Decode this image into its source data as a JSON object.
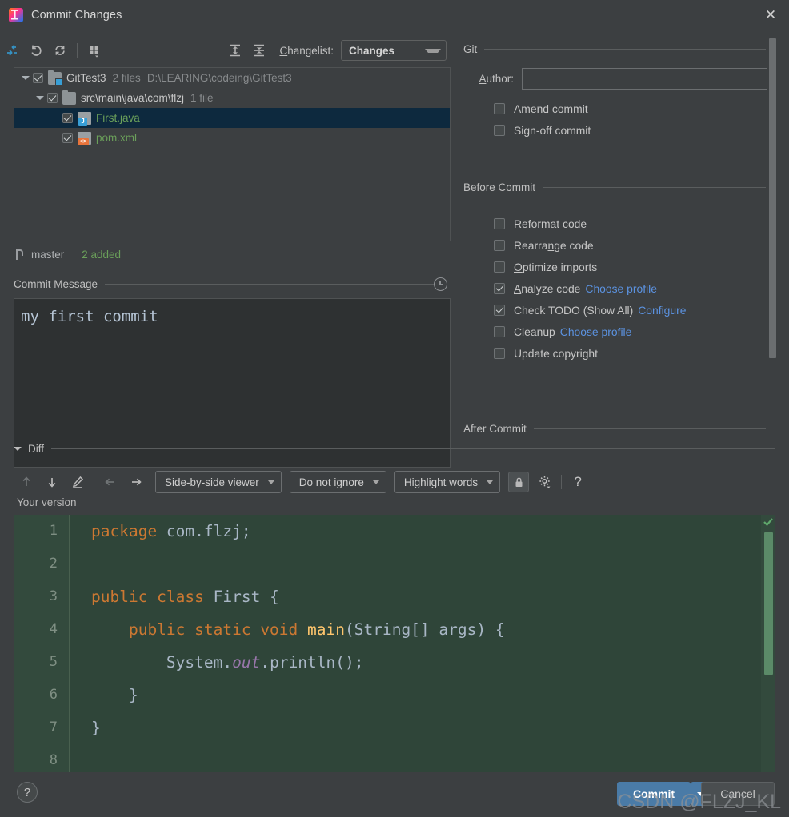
{
  "window": {
    "title": "Commit Changes",
    "app_icon": "intellij-idea-icon",
    "close_label": "✕"
  },
  "toolbar": {
    "icons": [
      "collapse-into-icon",
      "revert-icon",
      "refresh-icon",
      "group-by-icon",
      "expand-all-icon",
      "collapse-all-icon"
    ],
    "changelist_label": "Changelist:",
    "changelist_value": "Changes"
  },
  "tree": {
    "rows": [
      {
        "name": "GitTest3",
        "meta1": "2 files",
        "meta2": "D:\\LEARING\\codeing\\GitTest3",
        "icon": "folder-modified-icon",
        "checked": true,
        "expanded": true,
        "indent": 0,
        "selected": false,
        "color": "default"
      },
      {
        "name": "src\\main\\java\\com\\flzj",
        "meta1": "1 file",
        "meta2": "",
        "icon": "folder-icon",
        "checked": true,
        "expanded": true,
        "indent": 1,
        "selected": false,
        "color": "default"
      },
      {
        "name": "First.java",
        "meta1": "",
        "meta2": "",
        "icon": "java-file-icon",
        "checked": true,
        "expanded": null,
        "indent": 2,
        "selected": true,
        "color": "green"
      },
      {
        "name": "pom.xml",
        "meta1": "",
        "meta2": "",
        "icon": "maven-xml-file-icon",
        "checked": true,
        "expanded": null,
        "indent": 1,
        "selected": false,
        "color": "green"
      }
    ]
  },
  "branch_bar": {
    "icon": "git-branch-icon",
    "branch": "master",
    "stats": "2 added"
  },
  "commit_message": {
    "section_title": "Commit Message",
    "history_icon": "clock-history-icon",
    "value": "my first commit",
    "placeholder": ""
  },
  "git_section": {
    "title": "Git",
    "author_label": "Author:",
    "author_value": "",
    "author_placeholder": "",
    "options": [
      {
        "label": "Amend commit",
        "checked": false
      },
      {
        "label": "Sign-off commit",
        "checked": false
      }
    ]
  },
  "before_commit": {
    "title": "Before Commit",
    "options": [
      {
        "label": "Reformat code",
        "checked": false,
        "link": ""
      },
      {
        "label": "Rearrange code",
        "checked": false,
        "link": ""
      },
      {
        "label": "Optimize imports",
        "checked": false,
        "link": ""
      },
      {
        "label": "Analyze code",
        "checked": true,
        "link": "Choose profile"
      },
      {
        "label": "Check TODO (Show All)",
        "checked": true,
        "link": "Configure"
      },
      {
        "label": "Cleanup",
        "checked": false,
        "link": "Choose profile"
      },
      {
        "label": "Update copyright",
        "checked": false,
        "link": ""
      }
    ]
  },
  "after_commit": {
    "title": "After Commit"
  },
  "diff": {
    "section_title": "Diff",
    "nav_icons": [
      "previous-difference-icon",
      "next-difference-icon",
      "edit-source-icon",
      "accept-left-icon",
      "accept-right-icon"
    ],
    "viewer_mode": "Side-by-side viewer",
    "ignore_policy": "Do not ignore",
    "highlight_policy": "Highlight words",
    "lock_icon": "lock-icon",
    "settings_icon": "gear-icon",
    "help_icon": "question-mark-icon",
    "pane_label": "Your version",
    "status_icon": "check-ok-icon",
    "line_numbers": [
      "1",
      "2",
      "3",
      "4",
      "5",
      "6",
      "7",
      "8"
    ],
    "code_lines": [
      [
        {
          "t": "package ",
          "c": "kw"
        },
        {
          "t": "com.flzj;",
          "c": "id"
        }
      ],
      [],
      [
        {
          "t": "public class ",
          "c": "kw"
        },
        {
          "t": "First {",
          "c": "id"
        }
      ],
      [
        {
          "t": "    public static void ",
          "c": "kw"
        },
        {
          "t": "main",
          "c": "fn"
        },
        {
          "t": "(String[] args) {",
          "c": "id"
        }
      ],
      [
        {
          "t": "        System.",
          "c": "id"
        },
        {
          "t": "out",
          "c": "st"
        },
        {
          "t": ".println();",
          "c": "id"
        }
      ],
      [
        {
          "t": "    }",
          "c": "id"
        }
      ],
      [
        {
          "t": "}",
          "c": "id"
        }
      ],
      []
    ]
  },
  "footer": {
    "help_label": "?",
    "commit_label": "Commit",
    "commit_dropdown_icon": "chevron-down-icon",
    "cancel_label": "Cancel",
    "watermark": "CSDN @FLZJ_KL"
  },
  "colors": {
    "background": "#3c3f41",
    "accent_blue": "#4a7ba7",
    "link_blue": "#5b92e0",
    "diff_added_bg": "#2f4539",
    "selection_blue": "#0d293e",
    "green_text": "#6ba05a"
  }
}
